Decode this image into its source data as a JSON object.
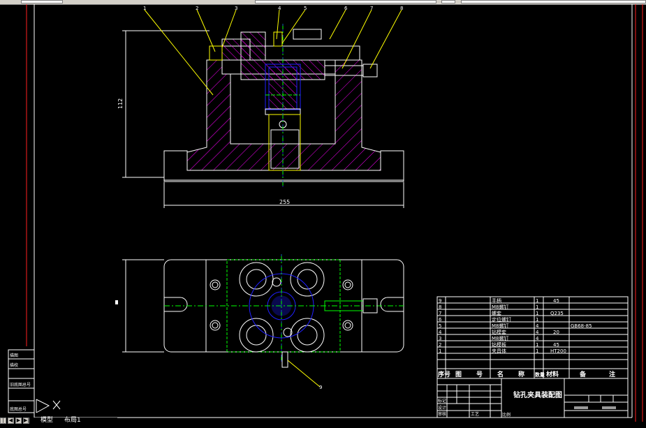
{
  "drawing": {
    "title": "钻孔夹具装配图",
    "dimension_height": "112",
    "dimension_width": "255",
    "callout_numbers": [
      "1",
      "2",
      "3",
      "4",
      "5",
      "6",
      "7",
      "8",
      "9"
    ],
    "bottom_callout": "9"
  },
  "bom": {
    "rows": [
      {
        "seq": "9",
        "name": "手柄",
        "qty": "1",
        "material": "45",
        "note": ""
      },
      {
        "seq": "8",
        "name": "M8螺钉",
        "qty": "1",
        "material": "",
        "note": ""
      },
      {
        "seq": "7",
        "name": "螺套",
        "qty": "1",
        "material": "Q235",
        "note": ""
      },
      {
        "seq": "6",
        "name": "定位螺钉",
        "qty": "1",
        "material": "",
        "note": ""
      },
      {
        "seq": "5",
        "name": "M8螺钉",
        "qty": "4",
        "material": "",
        "note": "GB68-85"
      },
      {
        "seq": "4",
        "name": "钻模套",
        "qty": "4",
        "material": "20",
        "note": ""
      },
      {
        "seq": "3",
        "name": "M8螺钉",
        "qty": "4",
        "material": "",
        "note": ""
      },
      {
        "seq": "2",
        "name": "钻模板",
        "qty": "1",
        "material": "45",
        "note": ""
      },
      {
        "seq": "1",
        "name": "夹具体",
        "qty": "1",
        "material": "HT200",
        "note": ""
      }
    ],
    "header": {
      "seq": "序号",
      "code": "图",
      "code2": "号",
      "name": "名",
      "name2": "称",
      "qty": "数量",
      "material": "材料",
      "note": "备",
      "note2": "注"
    }
  },
  "title_block": {
    "label_small_1": "标记",
    "label_small_2": "设计",
    "label_small_3": "审核",
    "label_small_4": "工艺",
    "label_small_5": "批准",
    "ratio_label": "比例"
  },
  "left_block": {
    "rows": [
      "描图",
      "描校",
      "旧底图总号",
      "底图总号"
    ]
  },
  "tabs": [
    "模型",
    "布局1"
  ],
  "colors": {
    "frame": "#ffffff",
    "border_red": "#ff2020",
    "hatch": "#ff00ff",
    "centerline": "#00ff00",
    "blue": "#2020ff",
    "leader": "#ffff00",
    "cyan": "#00c0ff"
  }
}
